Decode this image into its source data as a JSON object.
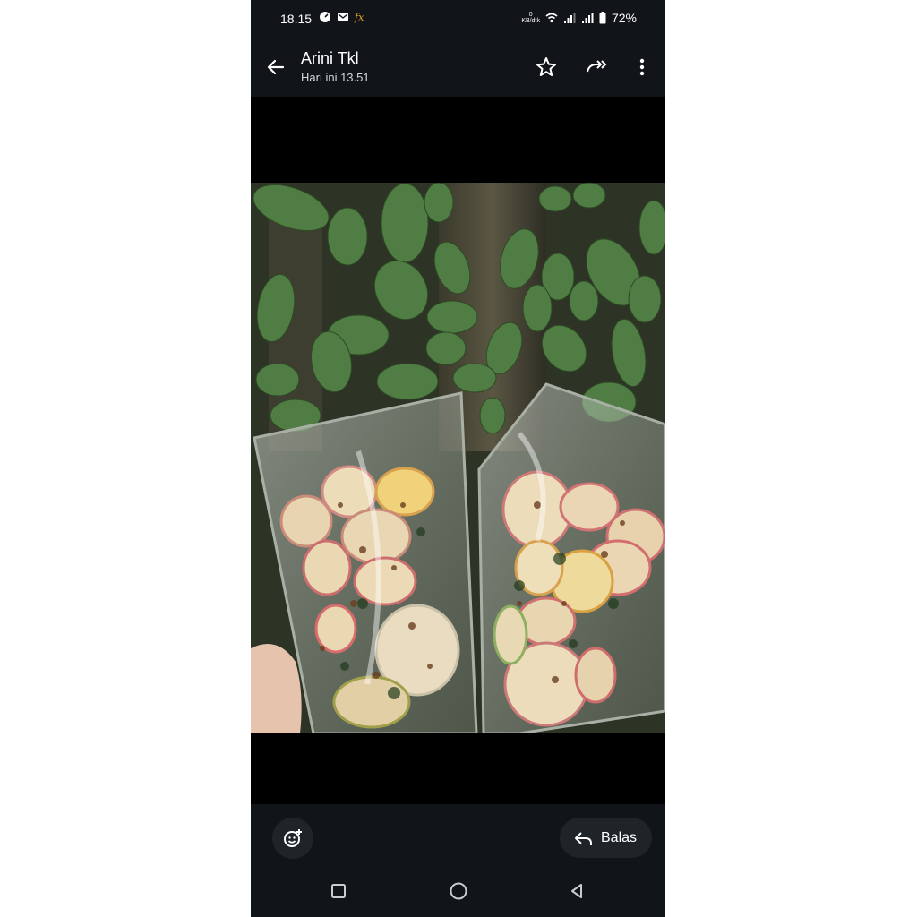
{
  "status_bar": {
    "time": "18.15",
    "net_speed_value": "0",
    "net_speed_unit": "KB/dtk",
    "battery": "72%",
    "icons": [
      "speedometer-icon",
      "mail-icon",
      "fx-icon",
      "wifi-icon",
      "signal-icon",
      "signal-icon",
      "battery-icon"
    ],
    "fx_label": "fx"
  },
  "header": {
    "title": "Arini Tkl",
    "subtitle": "Hari ini 13.51",
    "actions": [
      "star-icon",
      "forward-icon",
      "more-vert-icon"
    ]
  },
  "image": {
    "description_icon": "photo"
  },
  "bottom_bar": {
    "reply_label": "Balas",
    "emoji_icon": "add-reaction-icon"
  },
  "nav_bar": [
    "recents-icon",
    "home-icon",
    "back-icon"
  ],
  "colors": {
    "bar_bg": "#111519",
    "button_bg": "#1f2429",
    "text": "#ffffff"
  }
}
